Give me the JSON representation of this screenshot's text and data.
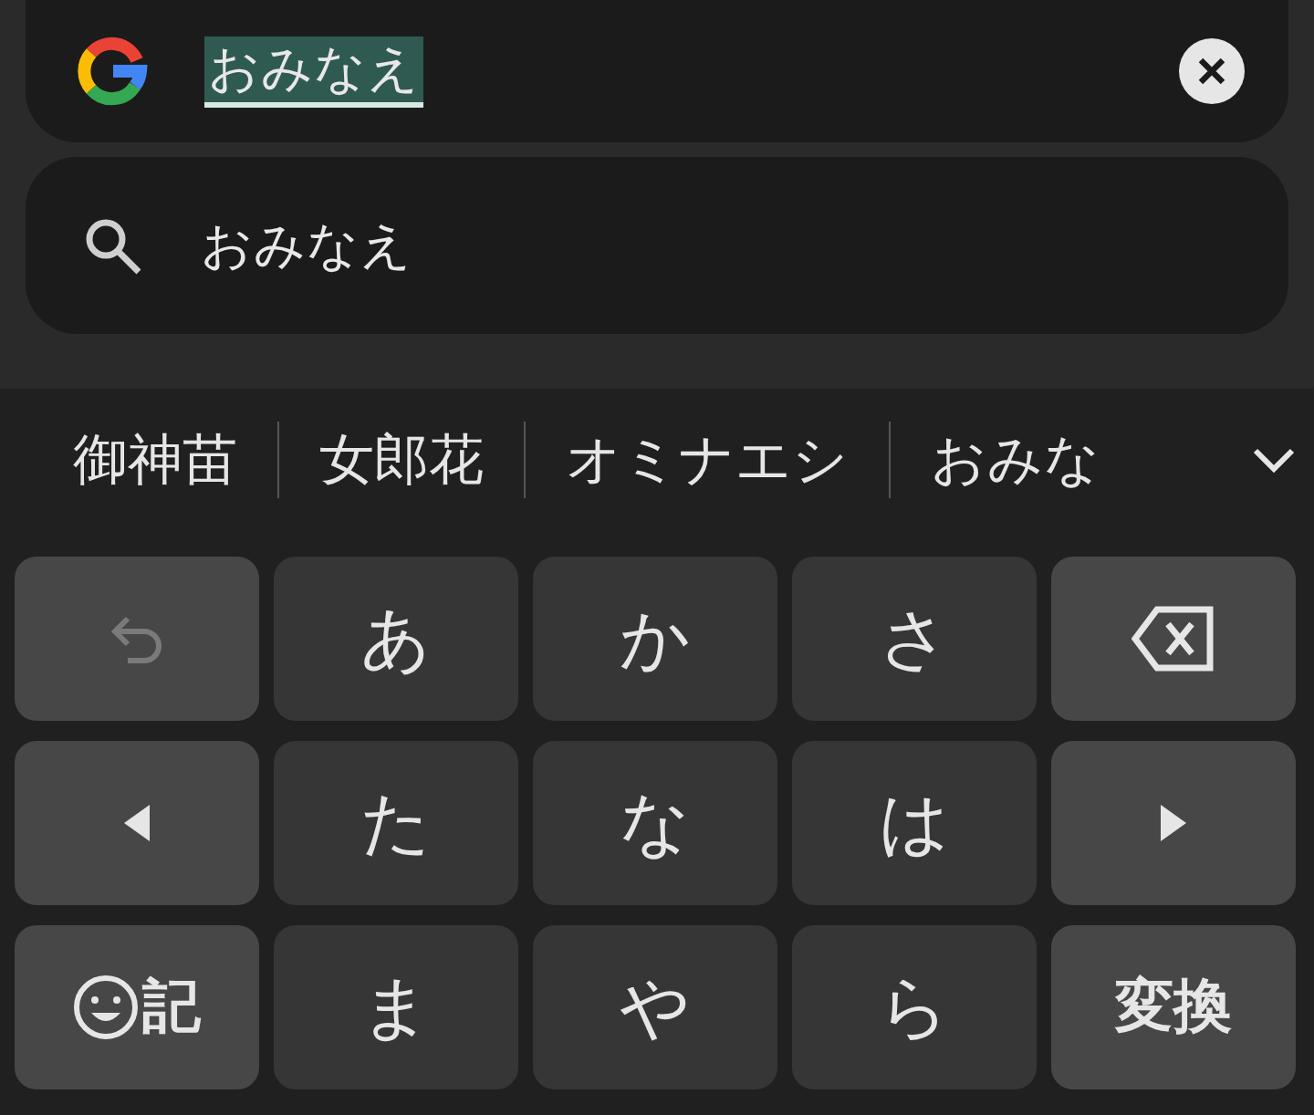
{
  "search_bar": {
    "value": "おみなえ",
    "composing": true
  },
  "suggestions": [
    {
      "text": "おみなえ"
    }
  ],
  "candidates": [
    "御神苗",
    "女郎花",
    "オミナエシ",
    "おみな"
  ],
  "keys": [
    {
      "kind": "undo",
      "disabled": true
    },
    {
      "kind": "char",
      "label": "あ"
    },
    {
      "kind": "char",
      "label": "か"
    },
    {
      "kind": "char",
      "label": "さ"
    },
    {
      "kind": "backspace"
    },
    {
      "kind": "left"
    },
    {
      "kind": "char",
      "label": "た"
    },
    {
      "kind": "char",
      "label": "な"
    },
    {
      "kind": "char",
      "label": "は"
    },
    {
      "kind": "right"
    },
    {
      "kind": "emoji",
      "label": "記"
    },
    {
      "kind": "char",
      "label": "ま"
    },
    {
      "kind": "char",
      "label": "や"
    },
    {
      "kind": "char",
      "label": "ら"
    },
    {
      "kind": "action",
      "label": "変換"
    }
  ]
}
